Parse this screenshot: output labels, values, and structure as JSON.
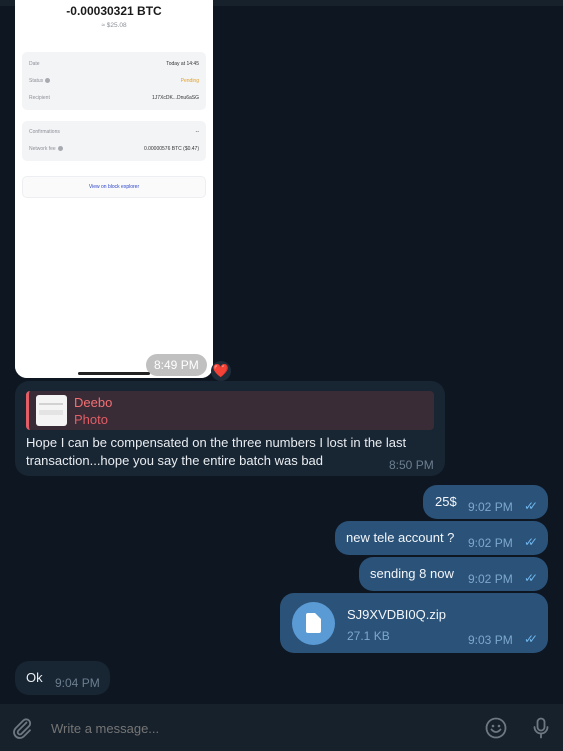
{
  "screenshot": {
    "amount": "-0.00030321 BTC",
    "usd": "≈ $25.08",
    "rows1": [
      {
        "key": "Date",
        "value": "Today at 14:45"
      },
      {
        "key": "Status",
        "value": "Pending"
      },
      {
        "key": "Recipient",
        "value": "1J7XcDK...Dnu6aSG"
      }
    ],
    "rows2": [
      {
        "key": "Confirmations",
        "value": "--"
      },
      {
        "key": "Network fee",
        "value": "0.00000576 BTC ($0.47)"
      }
    ],
    "explorer": "View on block explorer",
    "time": "8:49 PM",
    "reaction": "❤️"
  },
  "reply_message": {
    "quote_name": "Deebo",
    "quote_type": "Photo",
    "text": "Hope I can be compensated on the three numbers I lost in the last transaction...hope you say the entire batch was bad",
    "time": "8:50 PM"
  },
  "outgoing": [
    {
      "text": "25$",
      "time": "9:02 PM"
    },
    {
      "text": "new tele account ?",
      "time": "9:02 PM"
    },
    {
      "text": "sending 8 now",
      "time": "9:02 PM"
    }
  ],
  "file": {
    "name": "SJ9XVDBI0Q.zip",
    "size": "27.1 KB",
    "time": "9:03 PM"
  },
  "ok_message": {
    "text": "Ok",
    "time": "9:04 PM"
  },
  "composer": {
    "placeholder": "Write a message..."
  },
  "colors": {
    "background": "#0e1621",
    "incoming": "#182533",
    "outgoing": "#2b5278",
    "accent": "#6fb5ec"
  }
}
